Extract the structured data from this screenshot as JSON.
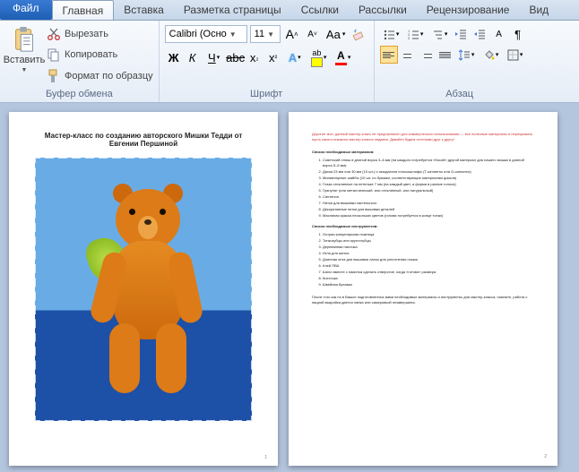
{
  "tabs": {
    "file": "Файл",
    "items": [
      "Главная",
      "Вставка",
      "Разметка страницы",
      "Ссылки",
      "Рассылки",
      "Рецензирование",
      "Вид"
    ],
    "active_index": 0
  },
  "ribbon": {
    "clipboard": {
      "label": "Буфер обмена",
      "paste": "Вставить",
      "cut": "Вырезать",
      "copy": "Копировать",
      "format_painter": "Формат по образцу"
    },
    "font": {
      "label": "Шрифт",
      "family": "Calibri (Осно",
      "size": "11"
    },
    "paragraph": {
      "label": "Абзац"
    }
  },
  "doc": {
    "page1": {
      "title": "Мастер-класс по созданию авторского Мишки Тедди от Евгении Першиной",
      "page_num": "1"
    },
    "page2": {
      "intro": "Дорогие мои, данный мастер-класс не предназначен для коммерческого использования — все полезные материалы и перекрывать пусть какого-никакого мастер-класса недавно. Давайте будем честными друг к другу!",
      "sect1_title": "Список необходимых материалов:",
      "sect1_items": [
        "Советский плюш в длиной ворса 3–6 мм (на каждого потребуется «босой» другой материал для нашего мишки в длиной ворса 5–6 мм)",
        "Диски 23 мм или 30 мм (10 шт.) и газодаталя плоскошлифы (Т-шплинты или О-шплинты)",
        "Миниатюрные шайбы (10 шт. по бумажи, соответствующие материалам дисков)",
        "Глаза стеклянные на петельке 7 мм (на каждый цвет, а форма в разные голоса)",
        "Гранулят (или металлический, или стеклянный, или натуральный)",
        "Синтепон",
        "Нитки для вышивки пастельного",
        "Декоративные нитки для вышивки деталей",
        "Масляная краска нескольких цветов (голова потребуется в конце тонах)"
      ],
      "sect2_title": "Список необходимых инструментов:",
      "sect2_items": [
        "Острая канцелярская ножница",
        "Тонкозубцы или круглогубцы",
        "Деревянная палочка",
        "Игла для шитья",
        "Длинная игла для вышивки лапок для уплотнения глазок",
        "Клей ПВА",
        "Шило вместе с намотка сделать отверстие, когда «готово» размера",
        "Кисточка",
        "Швейная булавка"
      ],
      "outro": "После того как по в Ваших подготовленных вами необходимые материалы и инструменты для мастер-класса, помните, работа с пациой выкройка дается лапка или самеровкой незавершена.",
      "page_num": "2"
    }
  }
}
